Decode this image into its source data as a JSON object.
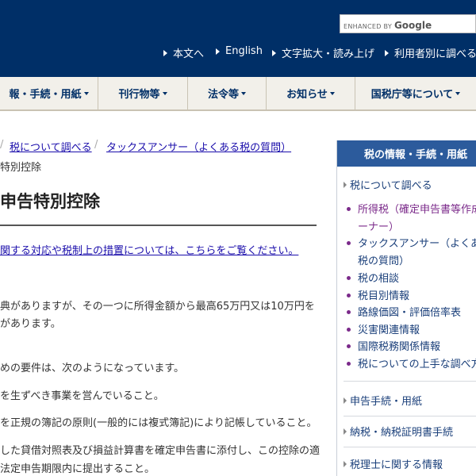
{
  "header": {
    "search": {
      "enhanced_by": "ENHANCED BY",
      "brand": "Google"
    },
    "utility_links": [
      "本文へ",
      "English",
      "文字拡大・読み上げ",
      "利用者別に調べる"
    ]
  },
  "gnav": {
    "items": [
      "報・手続・用紙",
      "刊行物等",
      "法令等",
      "お知らせ",
      "国税庁等について"
    ]
  },
  "breadcrumb": {
    "items": [
      "税について調べる",
      "タックスアンサー（よくある税の質問）"
    ],
    "separator": "/",
    "current": "特別控除"
  },
  "main": {
    "title": "申告特別控除",
    "notice": "関する対応や税制上の措置については、こちらをご覧ください。",
    "paragraphs": [
      "典がありますが、その一つに所得金額から最高65万円又は10万円を",
      "があります。",
      "めの要件は、次のようになっています。",
      "を生ずべき事業を営んでいること。",
      "を正規の簿記の原則(一般的には複式簿記)により記帳していること。",
      "した貸借対照表及び損益計算書を確定申告書に添付し、この控除の適",
      "法定申告期限内に提出すること。"
    ]
  },
  "sidebar": {
    "heading": "税の情報・手続・用紙",
    "section_top": "税について調べる",
    "items": [
      {
        "line1": "所得税（確定申告書等作成",
        "line2": "ーナー）",
        "visited": true
      },
      {
        "line1": "タックスアンサー（よくあ",
        "line2": "税の質問）",
        "visited": false
      },
      {
        "line1": "税の相談",
        "visited": false
      },
      {
        "line1": "税目別情報",
        "visited": false
      },
      {
        "line1": "路線価図・評価倍率表",
        "visited": false
      },
      {
        "line1": "災害関連情報",
        "visited": false
      },
      {
        "line1": "国際税務関係情報",
        "visited": false
      },
      {
        "line1": "税についての上手な調べ方",
        "visited": false
      }
    ],
    "sections": [
      "申告手続・用紙",
      "納税・納税証明書手続",
      "税理士に関する情報"
    ]
  }
}
